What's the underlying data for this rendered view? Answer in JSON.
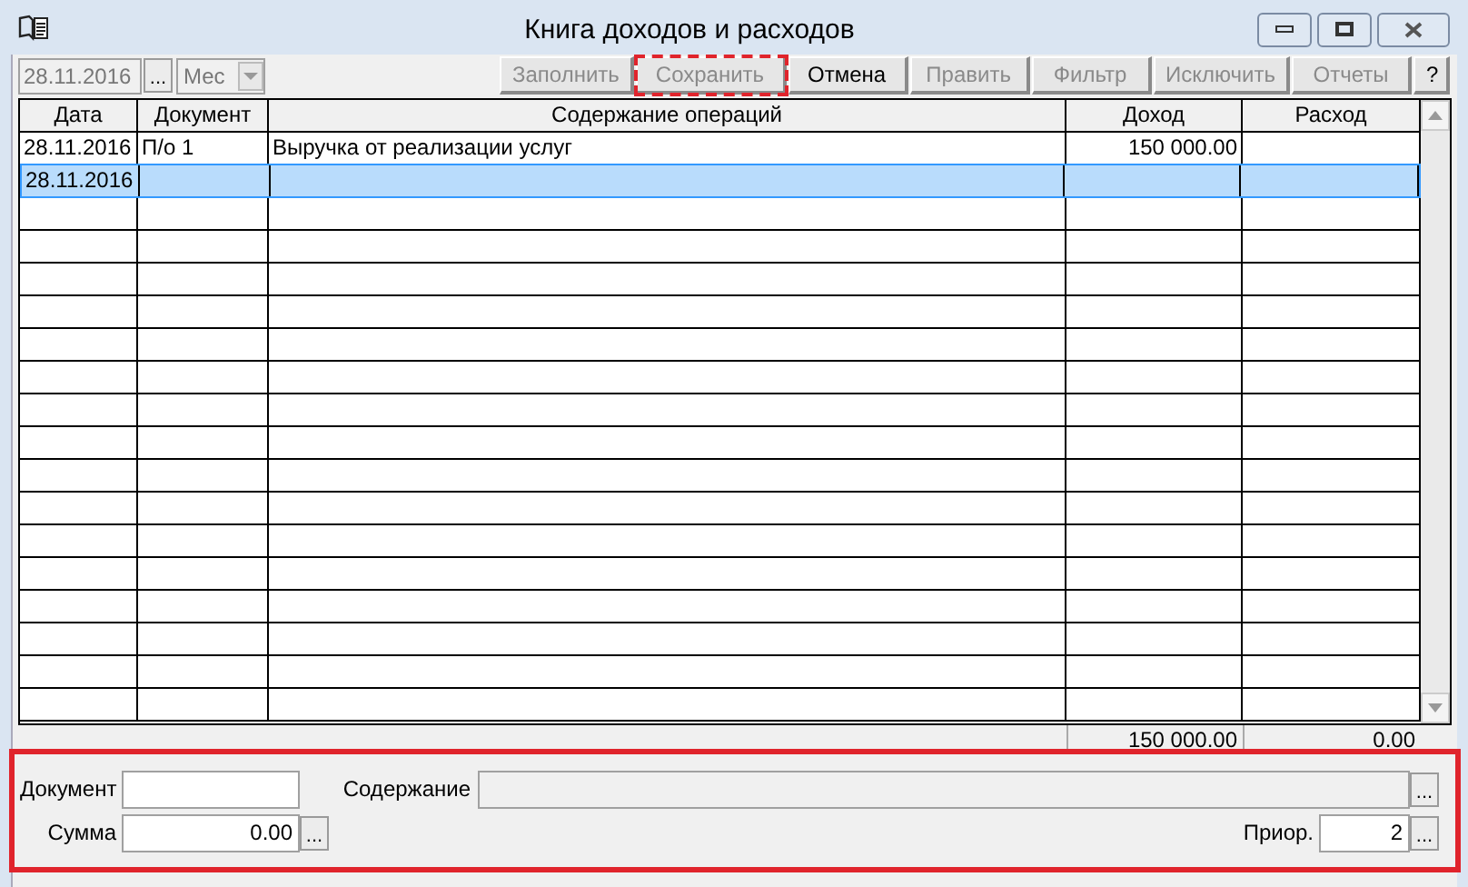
{
  "window": {
    "title": "Книга доходов и расходов"
  },
  "toolbar": {
    "date": {
      "value": "28.11.2016",
      "disabled": true
    },
    "date_button": "...",
    "period": {
      "value": "Мес",
      "disabled": true
    },
    "buttons": [
      {
        "label": "Заполнить",
        "disabled": true,
        "selected": false
      },
      {
        "label": "Сохранить",
        "disabled": true,
        "selected": true
      },
      {
        "label": "Отмена",
        "disabled": false,
        "selected": false
      },
      {
        "label": "Править",
        "disabled": true,
        "selected": false
      },
      {
        "label": "Фильтр",
        "disabled": true,
        "selected": false
      },
      {
        "label": "Исключить",
        "disabled": true,
        "selected": false
      },
      {
        "label": "Отчеты",
        "disabled": true,
        "selected": false
      },
      {
        "label": "?",
        "disabled": false,
        "selected": false
      }
    ]
  },
  "table": {
    "columns": [
      "Дата",
      "Документ",
      "Содержание операций",
      "Доход",
      "Расход"
    ],
    "rows": [
      {
        "selected": false,
        "cells": [
          "28.11.2016",
          "П/о 1",
          "Выручка от реализации услуг",
          "150 000.00",
          ""
        ]
      },
      {
        "selected": true,
        "cells": [
          "28.11.2016",
          "",
          "",
          "",
          ""
        ]
      }
    ],
    "totals": {
      "income": "150 000.00",
      "expense": "0.00"
    }
  },
  "form": {
    "document": {
      "label": "Документ"
    },
    "content": {
      "label": "Содержание",
      "button": "...",
      "disabled": true
    },
    "sum": {
      "label": "Сумма",
      "value": "0.00",
      "button": "..."
    },
    "priority": {
      "label": "Приор.",
      "value": "2",
      "button": "..."
    }
  }
}
